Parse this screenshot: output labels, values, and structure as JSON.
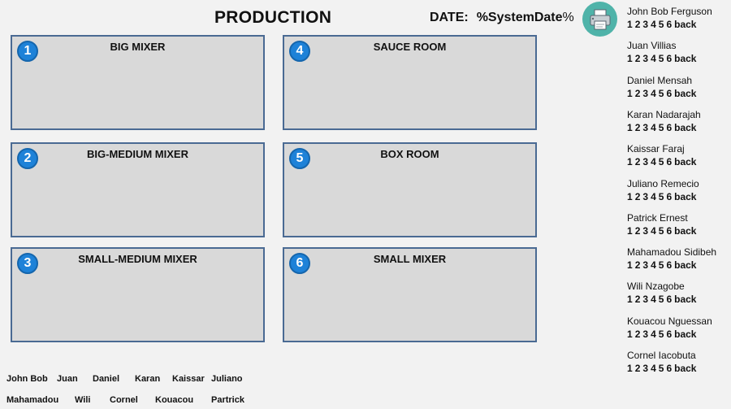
{
  "header": {
    "title": "PRODUCTION",
    "date_label": "DATE:",
    "date_value": "%SystemDate",
    "date_suffix": "%"
  },
  "icons": {
    "printer": "printer-icon"
  },
  "colors": {
    "badge": "#1e82d8",
    "room_border": "#4a6a93",
    "room_bg": "#d9d9d9",
    "printer_bg": "#4fb3a9"
  },
  "rooms": [
    {
      "number": "1",
      "name": "BIG MIXER"
    },
    {
      "number": "2",
      "name": "BIG-MEDIUM MIXER"
    },
    {
      "number": "3",
      "name": "SMALL-MEDIUM MIXER"
    },
    {
      "number": "4",
      "name": "SAUCE ROOM"
    },
    {
      "number": "5",
      "name": "BOX ROOM"
    },
    {
      "number": "6",
      "name": "SMALL MIXER"
    }
  ],
  "worker_options": [
    "1",
    "2",
    "3",
    "4",
    "5",
    "6",
    "back"
  ],
  "workers": [
    {
      "name": "John Bob Ferguson"
    },
    {
      "name": "Juan Villias"
    },
    {
      "name": "Daniel Mensah"
    },
    {
      "name": "Karan Nadarajah"
    },
    {
      "name": "Kaissar Faraj"
    },
    {
      "name": "Juliano Remecio"
    },
    {
      "name": "Patrick Ernest"
    },
    {
      "name": "Mahamadou Sidibeh"
    },
    {
      "name": "Wili Nzagobe"
    },
    {
      "name": "Kouacou Nguessan"
    },
    {
      "name": "Cornel Iacobuta"
    }
  ],
  "short_names": [
    "John Bob",
    "Juan",
    "Daniel",
    "Karan",
    "Kaissar",
    "Juliano",
    "Mahamadou",
    "Wili",
    "Cornel",
    "Kouacou",
    "Partrick"
  ]
}
